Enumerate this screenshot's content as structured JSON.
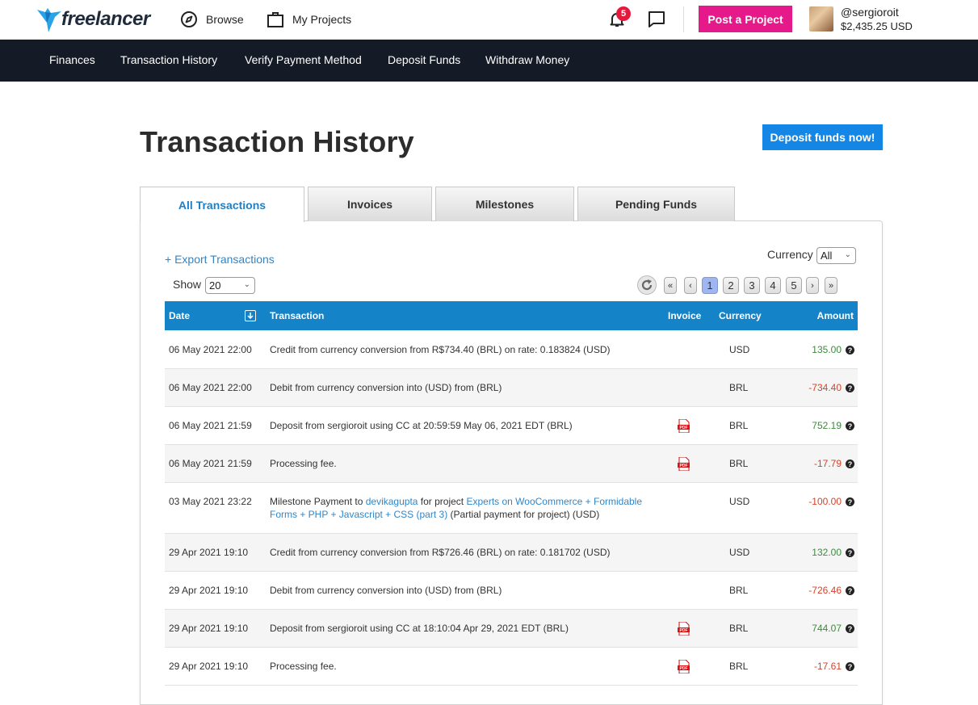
{
  "header": {
    "logo_text": "freelancer",
    "browse_label": "Browse",
    "projects_label": "My Projects",
    "notification_count": "5",
    "post_project_label": "Post a Project",
    "username": "@sergioroit",
    "balance": "$2,435.25 USD"
  },
  "subnav": {
    "items": [
      "Finances",
      "Transaction History",
      "Verify Payment Method",
      "Deposit Funds",
      "Withdraw Money"
    ]
  },
  "page": {
    "title": "Transaction History",
    "deposit_button": "Deposit funds now!"
  },
  "tabs": [
    "All Transactions",
    "Invoices",
    "Milestones",
    "Pending Funds"
  ],
  "controls": {
    "export_label": "+ Export Transactions",
    "currency_label": "Currency",
    "currency_value": "All",
    "show_label": "Show",
    "show_value": "20",
    "pagination": [
      "«",
      "‹",
      "1",
      "2",
      "3",
      "4",
      "5",
      "›",
      "»"
    ],
    "current_page": "1"
  },
  "table": {
    "headers": {
      "date": "Date",
      "transaction": "Transaction",
      "invoice": "Invoice",
      "currency": "Currency",
      "amount": "Amount"
    },
    "rows": [
      {
        "date": "06 May 2021 22:00",
        "transaction": "Credit from currency conversion from R$734.40 (BRL) on rate: 0.183824 (USD)",
        "invoice": false,
        "currency": "USD",
        "amount": "135.00",
        "sign": "pos"
      },
      {
        "date": "06 May 2021 22:00",
        "transaction": "Debit from currency conversion into (USD) from (BRL)",
        "invoice": false,
        "currency": "BRL",
        "amount": "-734.40",
        "sign": "neg"
      },
      {
        "date": "06 May 2021 21:59",
        "transaction": "Deposit from sergioroit using CC at 20:59:59 May 06, 2021 EDT (BRL)",
        "invoice": true,
        "currency": "BRL",
        "amount": "752.19",
        "sign": "pos"
      },
      {
        "date": "06 May 2021 21:59",
        "transaction": "Processing fee.",
        "invoice": true,
        "currency": "BRL",
        "amount": "-17.79",
        "sign": "neg"
      },
      {
        "date": "03 May 2021 23:22",
        "milestone": {
          "prefix": "Milestone Payment to ",
          "user": "devikagupta",
          "mid": " for project ",
          "project": "Experts on WooCommerce + Formidable Forms + PHP + Javascript + CSS (part 3)",
          "suffix": " (Partial payment for project) (USD)"
        },
        "invoice": false,
        "currency": "USD",
        "amount": "-100.00",
        "sign": "neg"
      },
      {
        "date": "29 Apr 2021 19:10",
        "transaction": "Credit from currency conversion from R$726.46 (BRL) on rate: 0.181702 (USD)",
        "invoice": false,
        "currency": "USD",
        "amount": "132.00",
        "sign": "pos"
      },
      {
        "date": "29 Apr 2021 19:10",
        "transaction": "Debit from currency conversion into (USD) from (BRL)",
        "invoice": false,
        "currency": "BRL",
        "amount": "-726.46",
        "sign": "neg"
      },
      {
        "date": "29 Apr 2021 19:10",
        "transaction": "Deposit from sergioroit using CC at 18:10:04 Apr 29, 2021 EDT (BRL)",
        "invoice": true,
        "currency": "BRL",
        "amount": "744.07",
        "sign": "pos"
      },
      {
        "date": "29 Apr 2021 19:10",
        "transaction": "Processing fee.",
        "invoice": true,
        "currency": "BRL",
        "amount": "-17.61",
        "sign": "neg"
      }
    ]
  },
  "colors": {
    "brand_blue": "#1487e6",
    "post_pink": "#e6198a",
    "subnav_bg": "#141b26",
    "table_header": "#1583c8",
    "positive": "#3f8a3f",
    "negative": "#d4432c"
  }
}
